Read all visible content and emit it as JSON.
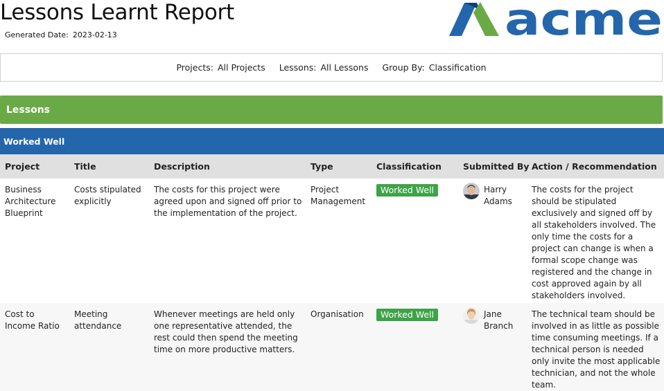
{
  "header": {
    "title": "Lessons Learnt Report",
    "generated_label": "Generated Date:",
    "generated_value": "2023-02-13",
    "logo_text": "acme"
  },
  "filters": {
    "projects_label": "Projects:",
    "projects_value": "All Projects",
    "lessons_label": "Lessons:",
    "lessons_value": "All Lessons",
    "group_label": "Group By:",
    "group_value": "Classification"
  },
  "section": {
    "title": "Lessons"
  },
  "group": {
    "title": "Worked Well"
  },
  "columns": [
    "Project",
    "Title",
    "Description",
    "Type",
    "Classification",
    "Submitted By",
    "Action / Recommendation"
  ],
  "rows": [
    {
      "project": "Business Architecture Blueprint",
      "title": "Costs stipulated explicitly",
      "description": "The costs for this project were agreed upon and signed off prior to the implementation of the project.",
      "type": "Project Management",
      "classification": "Worked Well",
      "submitted_by": "Harry Adams",
      "action": "The costs for the project should be stipulated exclusively and signed off by all stakeholders involved. The only time the costs for a project can change is when a formal scope change was registered and the change in cost approved again by all stakeholders involved."
    },
    {
      "project": "Cost to Income Ratio",
      "title": "Meeting attendance",
      "description": "Whenever meetings are held only one representative attended, the rest could then spend the meeting time on more productive matters.",
      "type": "Organisation",
      "classification": "Worked Well",
      "submitted_by": "Jane Branch",
      "action": "The technical team should be involved in as little as possible time consuming meetings. If a technical person is needed only invite the most applicable technician, and not the whole team."
    }
  ],
  "colors": {
    "lessons_bar": "#6aaa46",
    "group_bar": "#2466ab",
    "badge": "#3ea348",
    "logo_blue": "#2466ab",
    "logo_green": "#6aaa46"
  }
}
